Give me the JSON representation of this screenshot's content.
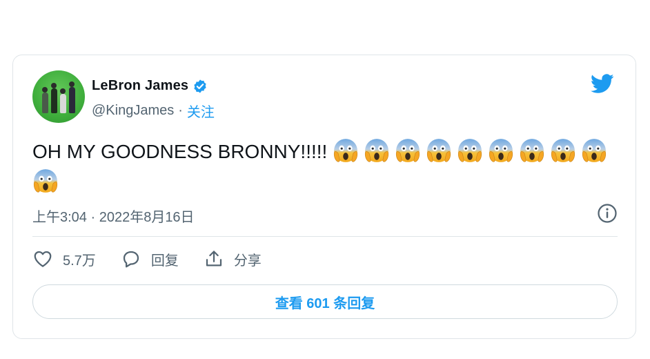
{
  "tweet": {
    "author": {
      "display_name": "LeBron James",
      "handle": "@KingJames",
      "separator": "·",
      "follow_label": "关注",
      "verified": true
    },
    "text": "OH MY GOODNESS BRONNY!!!!!",
    "emoji_name": "face-screaming-in-fear",
    "emoji_count": 10,
    "timestamp": "上午3:04 · 2022年8月16日",
    "actions": {
      "like_count": "5.7万",
      "reply_label": "回复",
      "share_label": "分享"
    },
    "view_replies_label": "查看 601 条回复"
  },
  "colors": {
    "accent": "#1d9bf0",
    "text_primary": "#0f1419",
    "text_secondary": "#536471",
    "border": "#dfe4e8"
  },
  "icons": [
    "twitter-bird-icon",
    "verified-badge-icon",
    "info-icon",
    "heart-icon",
    "reply-icon",
    "share-icon"
  ]
}
